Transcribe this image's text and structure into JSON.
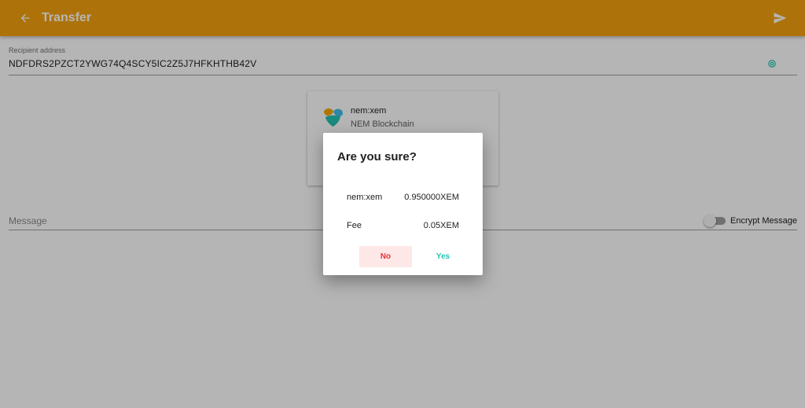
{
  "appbar": {
    "title": "Transfer",
    "back_icon": "arrow-left-icon",
    "send_icon": "send-icon",
    "bg_color": "#f4a20f"
  },
  "recipient": {
    "label": "Recipient address",
    "value": "NDFDRS2PZCT2YWG74Q4SCY5IC2Z5J7HFKHTHB42V",
    "icon": "at-sign-icon"
  },
  "mosaic": {
    "name": "nem:xem",
    "chain": "NEM Blockchain",
    "logo": "nem-logo-icon"
  },
  "message": {
    "placeholder": "Message",
    "encrypt_label": "Encrypt Message",
    "encrypt_on": false
  },
  "dialog": {
    "title": "Are you sure?",
    "amount_label": "nem:xem",
    "amount_value": "0.950000XEM",
    "fee_label": "Fee",
    "fee_value": "0.05XEM",
    "no_label": "No",
    "yes_label": "Yes",
    "no_color": "#e6323c",
    "yes_color": "#1ec6b5"
  }
}
